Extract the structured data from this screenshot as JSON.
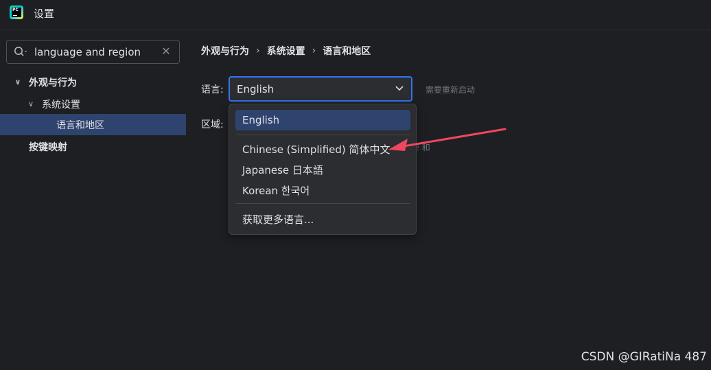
{
  "window": {
    "title": "设置",
    "app_icon": "pycharm-icon",
    "app_icon_text": "PC"
  },
  "sidebar": {
    "search": {
      "value": "language and region",
      "search_icon": "search-icon",
      "clear_icon": "close-icon"
    },
    "items": [
      {
        "label": "外观与行为",
        "expanded": true,
        "bold": true
      },
      {
        "label": "系统设置",
        "expanded": true,
        "bold": false
      },
      {
        "label": "语言和地区",
        "selected": true,
        "bold": false
      },
      {
        "label": "按键映射",
        "bold": true
      }
    ]
  },
  "breadcrumb": [
    "外观与行为",
    "系统设置",
    "语言和地区"
  ],
  "form": {
    "language_label": "语言:",
    "language_value": "English",
    "restart_note": "需要重新启动",
    "region_label": "区域:",
    "hint_fragment": "ce 和"
  },
  "dropdown": {
    "options": [
      "English",
      "Chinese (Simplified) 简体中文",
      "Japanese 日本語",
      "Korean 한국어"
    ],
    "selected": "English",
    "more_link": "获取更多语言..."
  },
  "watermark": "CSDN @GIRatiNa 487",
  "colors": {
    "background": "#1e1f22",
    "panel": "#2b2d30",
    "selection": "#2e436e",
    "focus_border": "#3574f0",
    "annotation_arrow": "#f0465f"
  }
}
